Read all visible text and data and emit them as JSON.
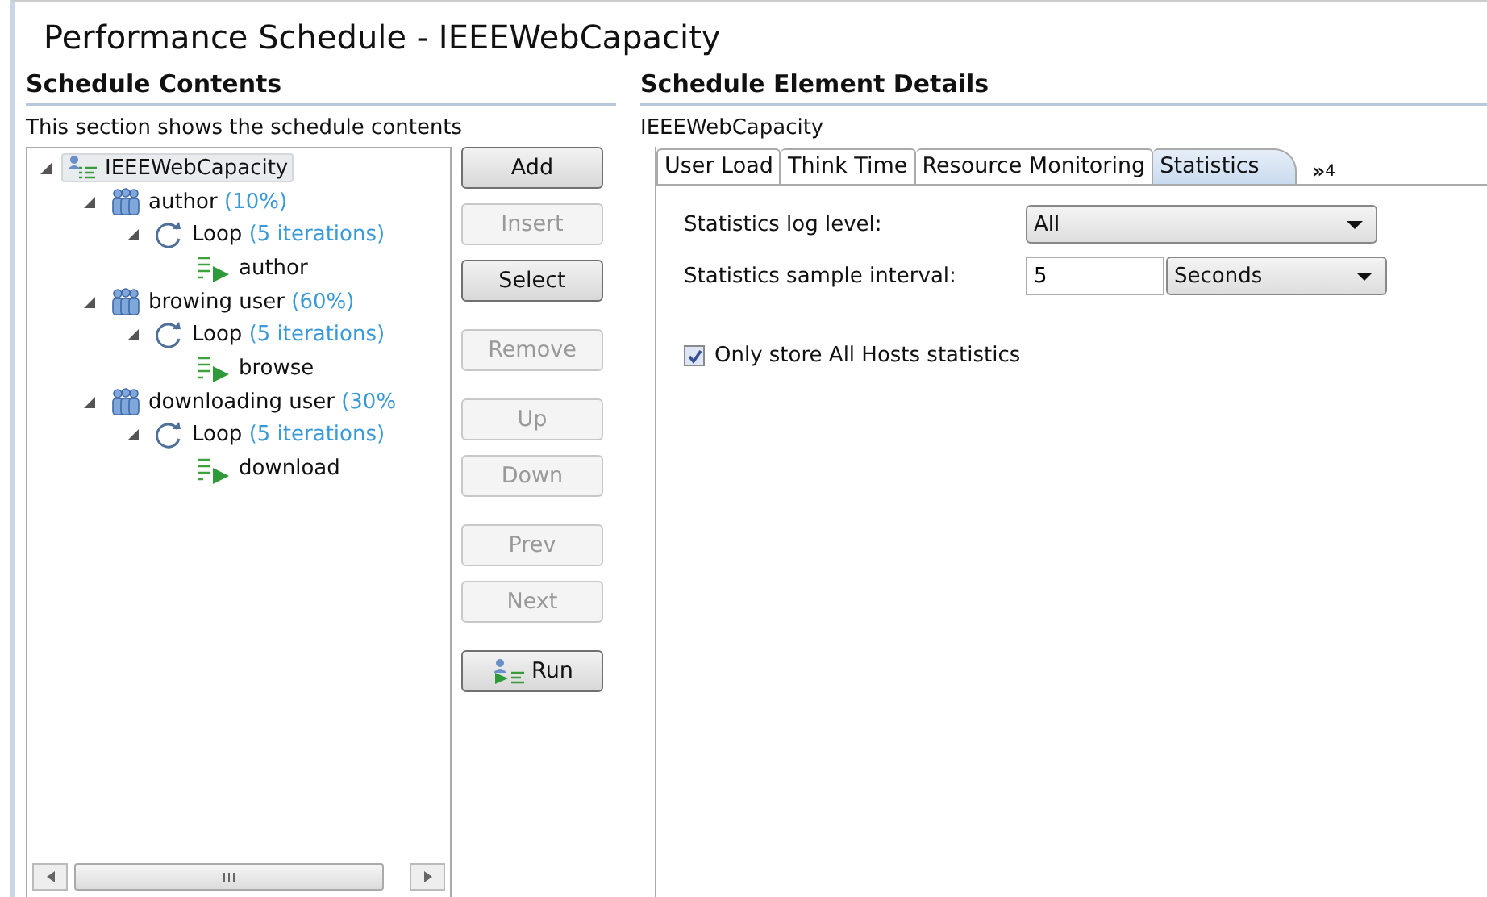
{
  "window": {
    "title": "Performance Schedule - IEEEWebCapacity"
  },
  "contents": {
    "heading": "Schedule Contents",
    "description": "This section shows the schedule contents",
    "tree": [
      {
        "kind": "schedule",
        "label": "IEEEWebCapacity",
        "selected": true,
        "expanded": true,
        "children": [
          {
            "kind": "group",
            "label": "author",
            "detail": "(10%)",
            "selected": false,
            "expanded": true,
            "children": [
              {
                "kind": "loop",
                "label": "Loop",
                "detail": "(5 iterations)",
                "selected": false,
                "expanded": true,
                "children": [
                  {
                    "kind": "test",
                    "label": "author",
                    "selected": false
                  }
                ]
              }
            ]
          },
          {
            "kind": "group",
            "label": "browing user",
            "detail": "(60%)",
            "selected": false,
            "expanded": true,
            "children": [
              {
                "kind": "loop",
                "label": "Loop",
                "detail": "(5 iterations)",
                "selected": false,
                "expanded": true,
                "children": [
                  {
                    "kind": "test",
                    "label": "browse",
                    "selected": false
                  }
                ]
              }
            ]
          },
          {
            "kind": "group",
            "label": "downloading user",
            "detail": "(30%",
            "selected": false,
            "expanded": true,
            "children": [
              {
                "kind": "loop",
                "label": "Loop",
                "detail": "(5 iterations)",
                "selected": false,
                "expanded": true,
                "children": [
                  {
                    "kind": "test",
                    "label": "download",
                    "selected": false
                  }
                ]
              }
            ]
          }
        ]
      }
    ],
    "button_groups": [
      [
        {
          "kind": "plain",
          "label": "Add",
          "disabled": false
        },
        {
          "kind": "plain",
          "label": "Insert",
          "disabled": true
        },
        {
          "kind": "plain",
          "label": "Select",
          "disabled": false
        }
      ],
      [
        {
          "kind": "plain",
          "label": "Remove",
          "disabled": true
        }
      ],
      [
        {
          "kind": "plain",
          "label": "Up",
          "disabled": true
        },
        {
          "kind": "plain",
          "label": "Down",
          "disabled": true
        }
      ],
      [
        {
          "kind": "plain",
          "label": "Prev",
          "disabled": true
        },
        {
          "kind": "plain",
          "label": "Next",
          "disabled": true
        }
      ],
      [
        {
          "kind": "run",
          "label": "Run",
          "disabled": false
        }
      ]
    ]
  },
  "details": {
    "heading": "Schedule Element Details",
    "element": "IEEEWebCapacity",
    "tabs": [
      {
        "label": "User Load",
        "selected": false
      },
      {
        "label": "Think Time",
        "selected": false
      },
      {
        "label": "Resource Monitoring",
        "selected": false
      },
      {
        "label": "Statistics",
        "selected": true
      }
    ],
    "overflow": {
      "glyph": "»",
      "count": "4"
    },
    "log_level": {
      "label": "Statistics log level:",
      "value": "All"
    },
    "sample_interval": {
      "label": "Statistics sample interval:",
      "value": "5",
      "unit": "Seconds"
    },
    "hosts_only": {
      "label": "Only store All Hosts statistics",
      "checked": true
    }
  }
}
